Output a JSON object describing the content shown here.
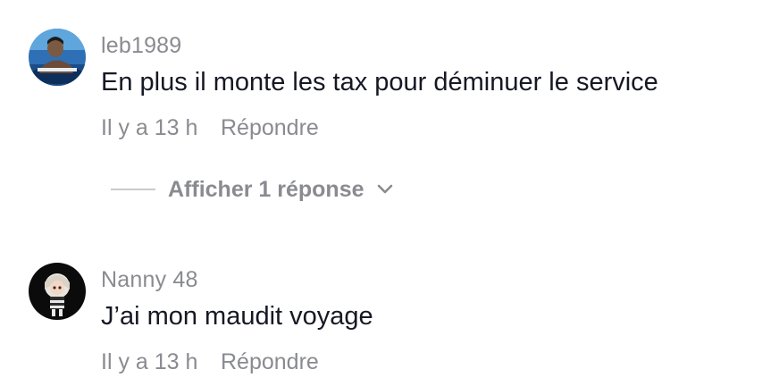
{
  "comments": [
    {
      "username": "leb1989",
      "text": "En plus il monte les tax pour déminuer le service",
      "time": "Il y a 13 h",
      "reply_label": "Répondre",
      "avatar_icon": "user-photo-pool"
    },
    {
      "username": "Nanny 48",
      "text": "J’ai mon maudit voyage",
      "time": "Il y a 13 h",
      "reply_label": "Répondre",
      "avatar_icon": "user-cartoon-avatar"
    }
  ],
  "view_replies": {
    "label": "Afficher 1 réponse",
    "icon": "chevron-down-icon"
  },
  "colors": {
    "primary_text": "#161823",
    "secondary_text": "#8a8b91",
    "divider": "#c9cacd",
    "background": "#ffffff"
  }
}
